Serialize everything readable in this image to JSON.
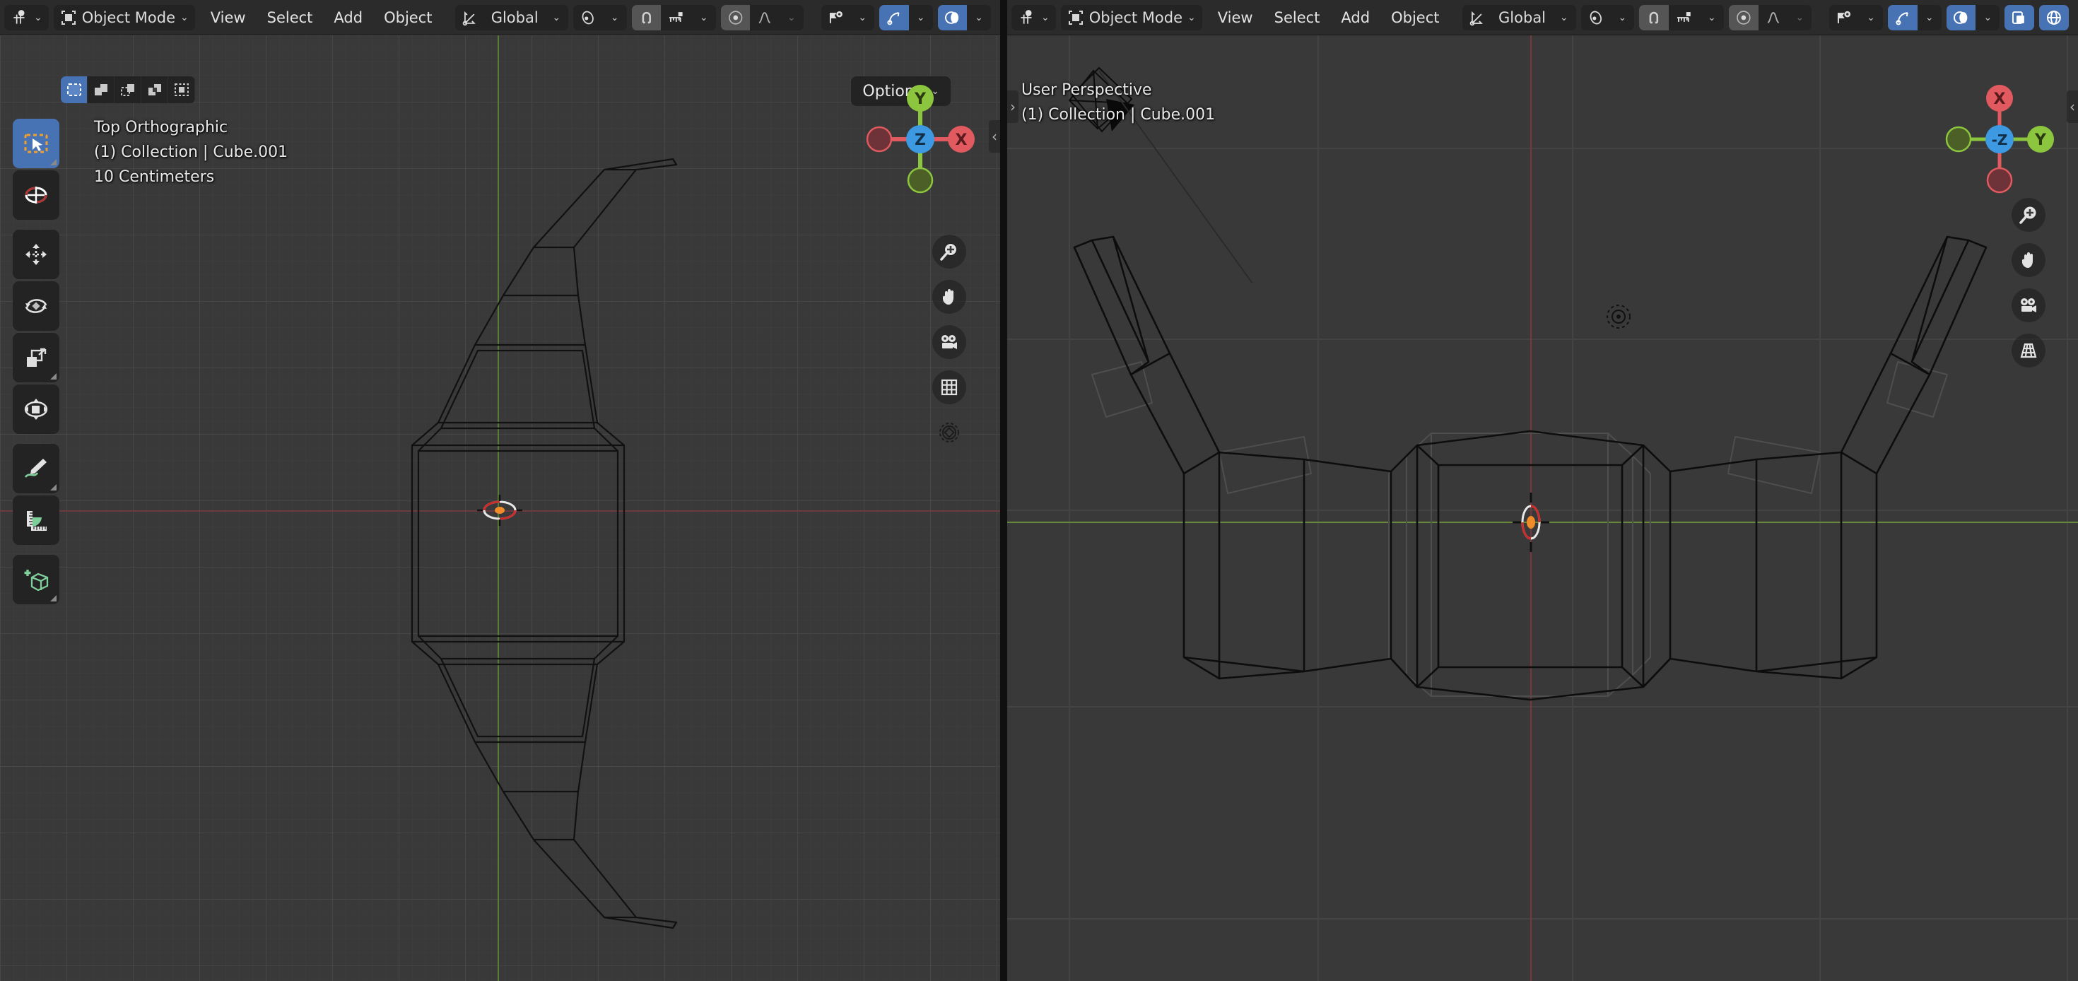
{
  "app": {
    "title": "Blender",
    "theme_bg": "#393939",
    "accent": "#4772b3",
    "header_bg": "#2b2b2b"
  },
  "viewports": [
    {
      "id": "left",
      "header": {
        "editor_type_icon": "editor-type-3dview-icon",
        "mode_icon": "object-mode-icon",
        "mode_label": "Object Mode",
        "menus": [
          "View",
          "Select",
          "Add",
          "Object"
        ],
        "transform_orientation_icon": "orientation-axis-icon",
        "transform_orientation": "Global",
        "snap_magnet_icon": "magnet-icon",
        "snap_target_icon": "snap-increment-icon",
        "proportional_edit_icon": "proportional-edit-icon",
        "proportional_falloff_icon": "falloff-curve-icon",
        "visibility_icon": "object-types-visibility-icon",
        "gizmo_icon": "gizmo-icon",
        "overlays_icon": "overlays-icon",
        "gizmo_on": true,
        "overlays_on": true
      },
      "overlay_text": {
        "line1": "Top Orthographic",
        "line2": "(1) Collection | Cube.001",
        "line3": "10 Centimeters"
      },
      "select_modes": [
        {
          "name": "tweak",
          "icon": "select-box-icon",
          "active": true
        },
        {
          "name": "set",
          "icon": "select-set-icon",
          "active": false
        },
        {
          "name": "extend",
          "icon": "select-extend-icon",
          "active": false
        },
        {
          "name": "subtract",
          "icon": "select-subtract-icon",
          "active": false
        },
        {
          "name": "intersect",
          "icon": "select-intersect-icon",
          "active": false
        }
      ],
      "options_label": "Options",
      "gizmo": {
        "center_label": "Z",
        "axis_pos_x_label": "X",
        "axis_pos_y_label": "Y",
        "colors": {
          "x": "#e05a5f",
          "y": "#8cc63e",
          "z": "#3d9ae2",
          "x_dim": "#6e3338",
          "y_dim": "#4b5f26"
        }
      },
      "nav_buttons": [
        {
          "name": "zoom-icon"
        },
        {
          "name": "hand-pan-icon"
        },
        {
          "name": "camera-view-icon"
        },
        {
          "name": "toggle-orthographic-grid-icon"
        },
        {
          "name": "gizmo-rotate-icon"
        }
      ]
    },
    {
      "id": "right",
      "header": {
        "editor_type_icon": "editor-type-3dview-icon",
        "mode_icon": "object-mode-icon",
        "mode_label": "Object Mode",
        "menus": [
          "View",
          "Select",
          "Add",
          "Object"
        ],
        "transform_orientation_icon": "orientation-axis-icon",
        "transform_orientation": "Global",
        "snap_magnet_icon": "magnet-icon",
        "snap_target_icon": "snap-increment-icon",
        "proportional_edit_icon": "proportional-edit-icon",
        "proportional_falloff_icon": "falloff-curve-icon",
        "visibility_icon": "object-types-visibility-icon",
        "gizmo_icon": "gizmo-icon",
        "overlays_icon": "overlays-icon",
        "xray_icon": "toggle-xray-icon",
        "shading_wireframe_icon": "shading-wireframe-icon",
        "shading_solid_icon": "shading-solid-icon",
        "gizmo_on": true,
        "overlays_on": true,
        "xray_on": true,
        "shading_on": true
      },
      "overlay_text": {
        "line1": "User Perspective",
        "line2": "(1) Collection | Cube.001"
      },
      "gizmo": {
        "center_label": "-Z",
        "axis_pos_x_label": "X",
        "axis_pos_y_label": "Y",
        "colors": {
          "x": "#e05a5f",
          "y": "#8cc63e",
          "z": "#3d9ae2",
          "x_dim": "#6e3338",
          "y_dim": "#4b5f26"
        }
      },
      "nav_buttons": [
        {
          "name": "zoom-icon"
        },
        {
          "name": "hand-pan-icon"
        },
        {
          "name": "camera-view-icon"
        },
        {
          "name": "toggle-perspective-grid-icon"
        }
      ]
    }
  ],
  "toolbar": {
    "tools": [
      {
        "name": "tweak-select-tool",
        "icon": "cursor-select-box-icon",
        "active": true,
        "has_submenu": true
      },
      {
        "name": "cursor-tool",
        "icon": "3d-cursor-icon",
        "active": false,
        "has_submenu": false
      },
      {
        "name": "move-tool",
        "icon": "move-arrows-icon",
        "active": false,
        "has_submenu": false,
        "group_start": true
      },
      {
        "name": "rotate-tool",
        "icon": "rotate-icon",
        "active": false,
        "has_submenu": false
      },
      {
        "name": "scale-tool",
        "icon": "scale-icon",
        "active": false,
        "has_submenu": true
      },
      {
        "name": "transform-tool",
        "icon": "transform-icon",
        "active": false,
        "has_submenu": false
      },
      {
        "name": "annotate-tool",
        "icon": "pencil-annotate-icon",
        "active": false,
        "has_submenu": true,
        "group_start": true
      },
      {
        "name": "measure-tool",
        "icon": "ruler-measure-icon",
        "active": false,
        "has_submenu": false
      },
      {
        "name": "add-cube-tool",
        "icon": "add-cube-icon",
        "active": false,
        "has_submenu": true,
        "group_start": true
      }
    ]
  },
  "scene": {
    "object_name": "Cube.001",
    "collection": "Collection",
    "grid_scale": "10 Centimeters",
    "cursor_3d_color": "#ef8b28",
    "objects_in_right_view": [
      "light-object",
      "mesh-cube-001"
    ]
  }
}
